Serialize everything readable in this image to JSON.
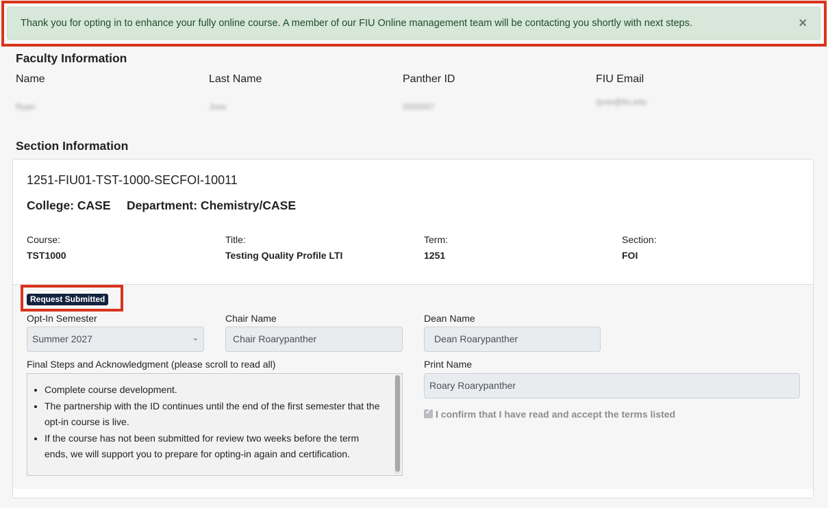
{
  "alert": {
    "message": "Thank you for opting in to enhance your fully online course. A member of our FIU Online management team will be contacting you shortly with next steps.",
    "close": "×"
  },
  "faculty": {
    "heading": "Faculty Information",
    "columns": [
      {
        "label": "Name",
        "value": "Ryan"
      },
      {
        "label": "Last Name",
        "value": "Jose"
      },
      {
        "label": "Panther ID",
        "value": "0000007"
      },
      {
        "label": "FIU Email",
        "value": "rjose@fiu.edu"
      }
    ]
  },
  "section": {
    "heading": "Section Information",
    "id": "1251-FIU01-TST-1000-SECFOI-10011",
    "college": "College: CASE",
    "department": "Department: Chemistry/CASE",
    "fields": [
      {
        "label": "Course:",
        "value": "TST1000"
      },
      {
        "label": "Title:",
        "value": "Testing Quality Profile LTI"
      },
      {
        "label": "Term:",
        "value": "1251"
      },
      {
        "label": "Section:",
        "value": "FOI"
      }
    ]
  },
  "status_badge": "Request Submitted",
  "form": {
    "opt_in_label": "Opt-In Semester",
    "opt_in_value": "Summer 2027",
    "chair_label": "Chair Name",
    "chair_value": "Chair Roarypanther",
    "dean_label": "Dean Name",
    "dean_value": "Dean Roarypanther",
    "ack_label": "Final Steps and Acknowledgment (please scroll to read all)",
    "ack_items": [
      "Complete course development.",
      "The partnership with the ID continues until the end of the first semester that the opt-in course is live.",
      "If the course has not been submitted for review two weeks before the term ends, we will support you to prepare for opting-in again and certification."
    ],
    "print_label": "Print Name",
    "print_value": "Roary Roarypanther",
    "confirm_label": "I confirm that I have read and accept the terms listed",
    "confirm_checked": true
  }
}
